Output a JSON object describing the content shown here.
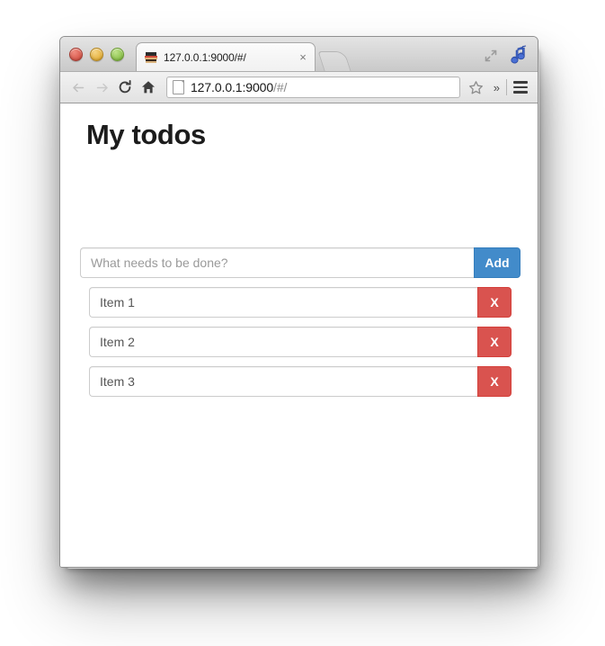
{
  "browser": {
    "traffic_lights": [
      {
        "name": "close-button",
        "color": "#d8594c"
      },
      {
        "name": "minimize-button",
        "color": "#e5b23e"
      },
      {
        "name": "zoom-button",
        "color": "#8cc24c"
      }
    ],
    "tab": {
      "title": "127.0.0.1:9000/#/",
      "favicon": "site-favicon",
      "close_label": "×"
    },
    "new_tab_label": "",
    "tabstrip_icons": [
      {
        "name": "expand-fullscreen-icon"
      },
      {
        "name": "music-note-icon"
      }
    ],
    "toolbar": {
      "back_icon": "back-arrow-icon",
      "forward_icon": "forward-arrow-icon",
      "reload_icon": "reload-icon",
      "home_icon": "home-icon",
      "page_icon": "page-document-icon",
      "url_host": "127.0.0.1:9000",
      "url_path": "/#/",
      "star_icon": "bookmark-star-icon",
      "overflow_label": "»",
      "menu_icon": "hamburger-menu-icon"
    }
  },
  "page": {
    "title": "My todos",
    "add_form": {
      "input_value": "",
      "input_placeholder": "What needs to be done?",
      "add_label": "Add"
    },
    "todos": [
      {
        "label": "Item 1",
        "delete_label": "X"
      },
      {
        "label": "Item 2",
        "delete_label": "X"
      },
      {
        "label": "Item 3",
        "delete_label": "X"
      }
    ]
  },
  "colors": {
    "primary": "#428bca",
    "danger": "#d9534f",
    "text": "#555555",
    "heading": "#1c1c1c"
  }
}
